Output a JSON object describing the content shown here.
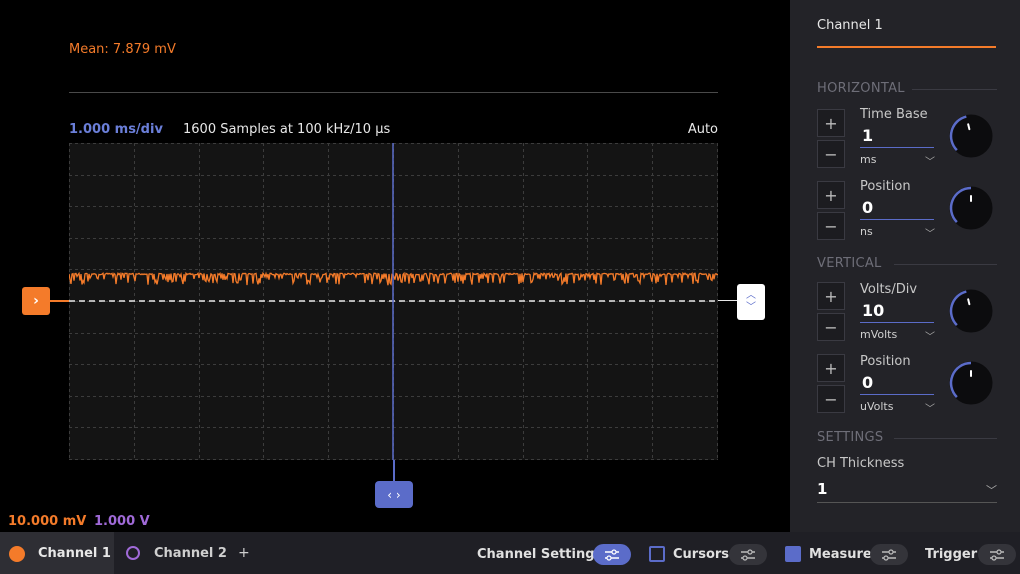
{
  "scope": {
    "mean_text": "Mean: 7.879 mV",
    "timebase_text": "1.000 ms/div",
    "samples_text": "1600 Samples at 100 kHz/10 µs",
    "trigger_mode": "Auto",
    "channel_marker_icon": "chevron-right-icon",
    "trigger_marker_icons": [
      "chevron-up-icon",
      "chevron-down-icon"
    ],
    "position_handle_icon": "chevron-left-right-icon",
    "ch1_scale": "10.000 mV",
    "ch2_scale": "1.000 V",
    "colors": {
      "ch1": "#f47b2a",
      "ch2": "#a06ad8",
      "accent": "#5b6cc9"
    }
  },
  "panel": {
    "title": "Channel 1",
    "horizontal": {
      "section": "HORIZONTAL",
      "time_base": {
        "label": "Time Base",
        "value": "1",
        "unit": "ms",
        "knob_level": 0.45
      },
      "position": {
        "label": "Position",
        "value": "0",
        "unit": "ns",
        "knob_level": 0.5
      }
    },
    "vertical": {
      "section": "VERTICAL",
      "volts_div": {
        "label": "Volts/Div",
        "value": "10",
        "unit": "mVolts",
        "knob_level": 0.45
      },
      "position": {
        "label": "Position",
        "value": "0",
        "unit": "uVolts",
        "knob_level": 0.5
      }
    },
    "settings": {
      "section": "SETTINGS",
      "thickness_label": "CH Thickness",
      "thickness_value": "1"
    },
    "plus": "+",
    "minus": "−"
  },
  "bottom": {
    "tab1": "Channel 1",
    "tab2": "Channel 2",
    "add": "+",
    "channel_settings": "Channel Settings",
    "cursors": "Cursors",
    "measure": "Measure",
    "trigger": "Trigger"
  }
}
